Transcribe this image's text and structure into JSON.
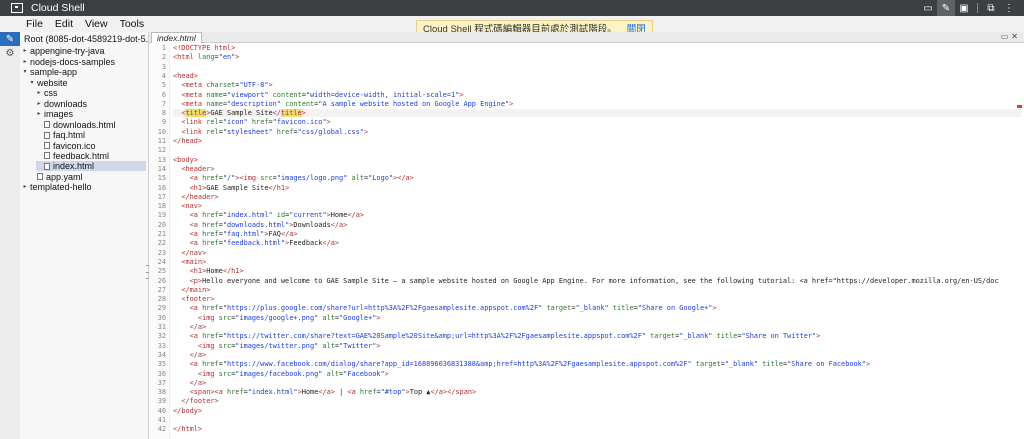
{
  "window": {
    "title": "Cloud Shell"
  },
  "titlebar_buttons": [
    {
      "name": "laptop-icon",
      "glyph": "▭"
    },
    {
      "name": "pencil-icon",
      "glyph": "✎"
    },
    {
      "name": "terminal-icon",
      "glyph": "▣"
    },
    {
      "name": "web-preview-icon",
      "glyph": "⧉"
    },
    {
      "name": "more-icon",
      "glyph": "⋮"
    }
  ],
  "menu": [
    "File",
    "Edit",
    "View",
    "Tools"
  ],
  "notice": {
    "text": "Cloud Shell 程式碼編輯器目前處於測試階段。",
    "close": "關閉"
  },
  "tree": [
    {
      "label": "Root (8085-dot-4589219-dot-5...",
      "level": 0,
      "kind": "root",
      "twist": ""
    },
    {
      "label": "appengine-try-java",
      "level": 0,
      "kind": "folder",
      "twist": "▸"
    },
    {
      "label": "nodejs-docs-samples",
      "level": 0,
      "kind": "folder",
      "twist": "▸"
    },
    {
      "label": "sample-app",
      "level": 0,
      "kind": "folder",
      "twist": "▾"
    },
    {
      "label": "website",
      "level": 1,
      "kind": "folder",
      "twist": "▾"
    },
    {
      "label": "css",
      "level": 2,
      "kind": "folder",
      "twist": "▸"
    },
    {
      "label": "downloads",
      "level": 2,
      "kind": "folder",
      "twist": "▸"
    },
    {
      "label": "images",
      "level": 2,
      "kind": "folder",
      "twist": "▸"
    },
    {
      "label": "downloads.html",
      "level": 2,
      "kind": "file",
      "twist": ""
    },
    {
      "label": "faq.html",
      "level": 2,
      "kind": "file",
      "twist": ""
    },
    {
      "label": "favicon.ico",
      "level": 2,
      "kind": "file",
      "twist": ""
    },
    {
      "label": "feedback.html",
      "level": 2,
      "kind": "file",
      "twist": ""
    },
    {
      "label": "index.html",
      "level": 2,
      "kind": "file",
      "twist": "",
      "selected": true
    },
    {
      "label": "app.yaml",
      "level": 1,
      "kind": "file",
      "twist": ""
    },
    {
      "label": "templated-hello",
      "level": 0,
      "kind": "folder",
      "twist": "▸"
    }
  ],
  "editor": {
    "tab": "index.html",
    "current_line": 8,
    "lines": [
      "<!DOCTYPE html>",
      "<html lang=\"en\">",
      "",
      "<head>",
      "  <meta charset=\"UTF-8\">",
      "  <meta name=\"viewport\" content=\"width=device-width, initial-scale=1\">",
      "  <meta name=\"description\" content=\"A sample website hosted on Google App Engine\">",
      "  <title>GAE Sample Site</title>",
      "  <link rel=\"icon\" href=\"favicon.ico\">",
      "  <link rel=\"stylesheet\" href=\"css/global.css\">",
      "</head>",
      "",
      "<body>",
      "  <header>",
      "    <a href=\"/\"><img src=\"images/logo.png\" alt=\"Logo\"></a>",
      "    <h1>GAE Sample Site</h1>",
      "  </header>",
      "  <nav>",
      "    <a href=\"index.html\" id=\"current\">Home</a>",
      "    <a href=\"downloads.html\">Downloads</a>",
      "    <a href=\"faq.html\">FAQ</a>",
      "    <a href=\"feedback.html\">Feedback</a>",
      "  </nav>",
      "  <main>",
      "    <h1>Home</h1>",
      "    <p>Hello everyone and welcome to GAE Sample Site – a sample website hosted on Google App Engine. For more information, see the following tutorial: <a href=\"https://developer.mozilla.org/en-US/doc",
      "  </main>",
      "  <footer>",
      "    <a href=\"https://plus.google.com/share?url=http%3A%2F%2Fgaesamplesite.appspot.com%2F\" target=\"_blank\" title=\"Share on Google+\">",
      "      <img src=\"images/google+.png\" alt=\"Google+\">",
      "    </a>",
      "    <a href=\"https://twitter.com/share?text=GAE%20Sample%20Site&amp;url=http%3A%2F%2Fgaesamplesite.appspot.com%2F\" target=\"_blank\" title=\"Share on Twitter\">",
      "      <img src=\"images/twitter.png\" alt=\"Twitter\">",
      "    </a>",
      "    <a href=\"https://www.facebook.com/dialog/share?app_id=168896036831388&amp;href=http%3A%2F%2Fgaesamplesite.appspot.com%2F\" target=\"_blank\" title=\"Share on Facebook\">",
      "      <img src=\"images/facebook.png\" alt=\"Facebook\">",
      "    </a>",
      "    <span><a href=\"index.html\">Home</a> | <a href=\"#top\">Top ▲</a></span>",
      "  </footer>",
      "</body>",
      "",
      "</html>"
    ]
  }
}
